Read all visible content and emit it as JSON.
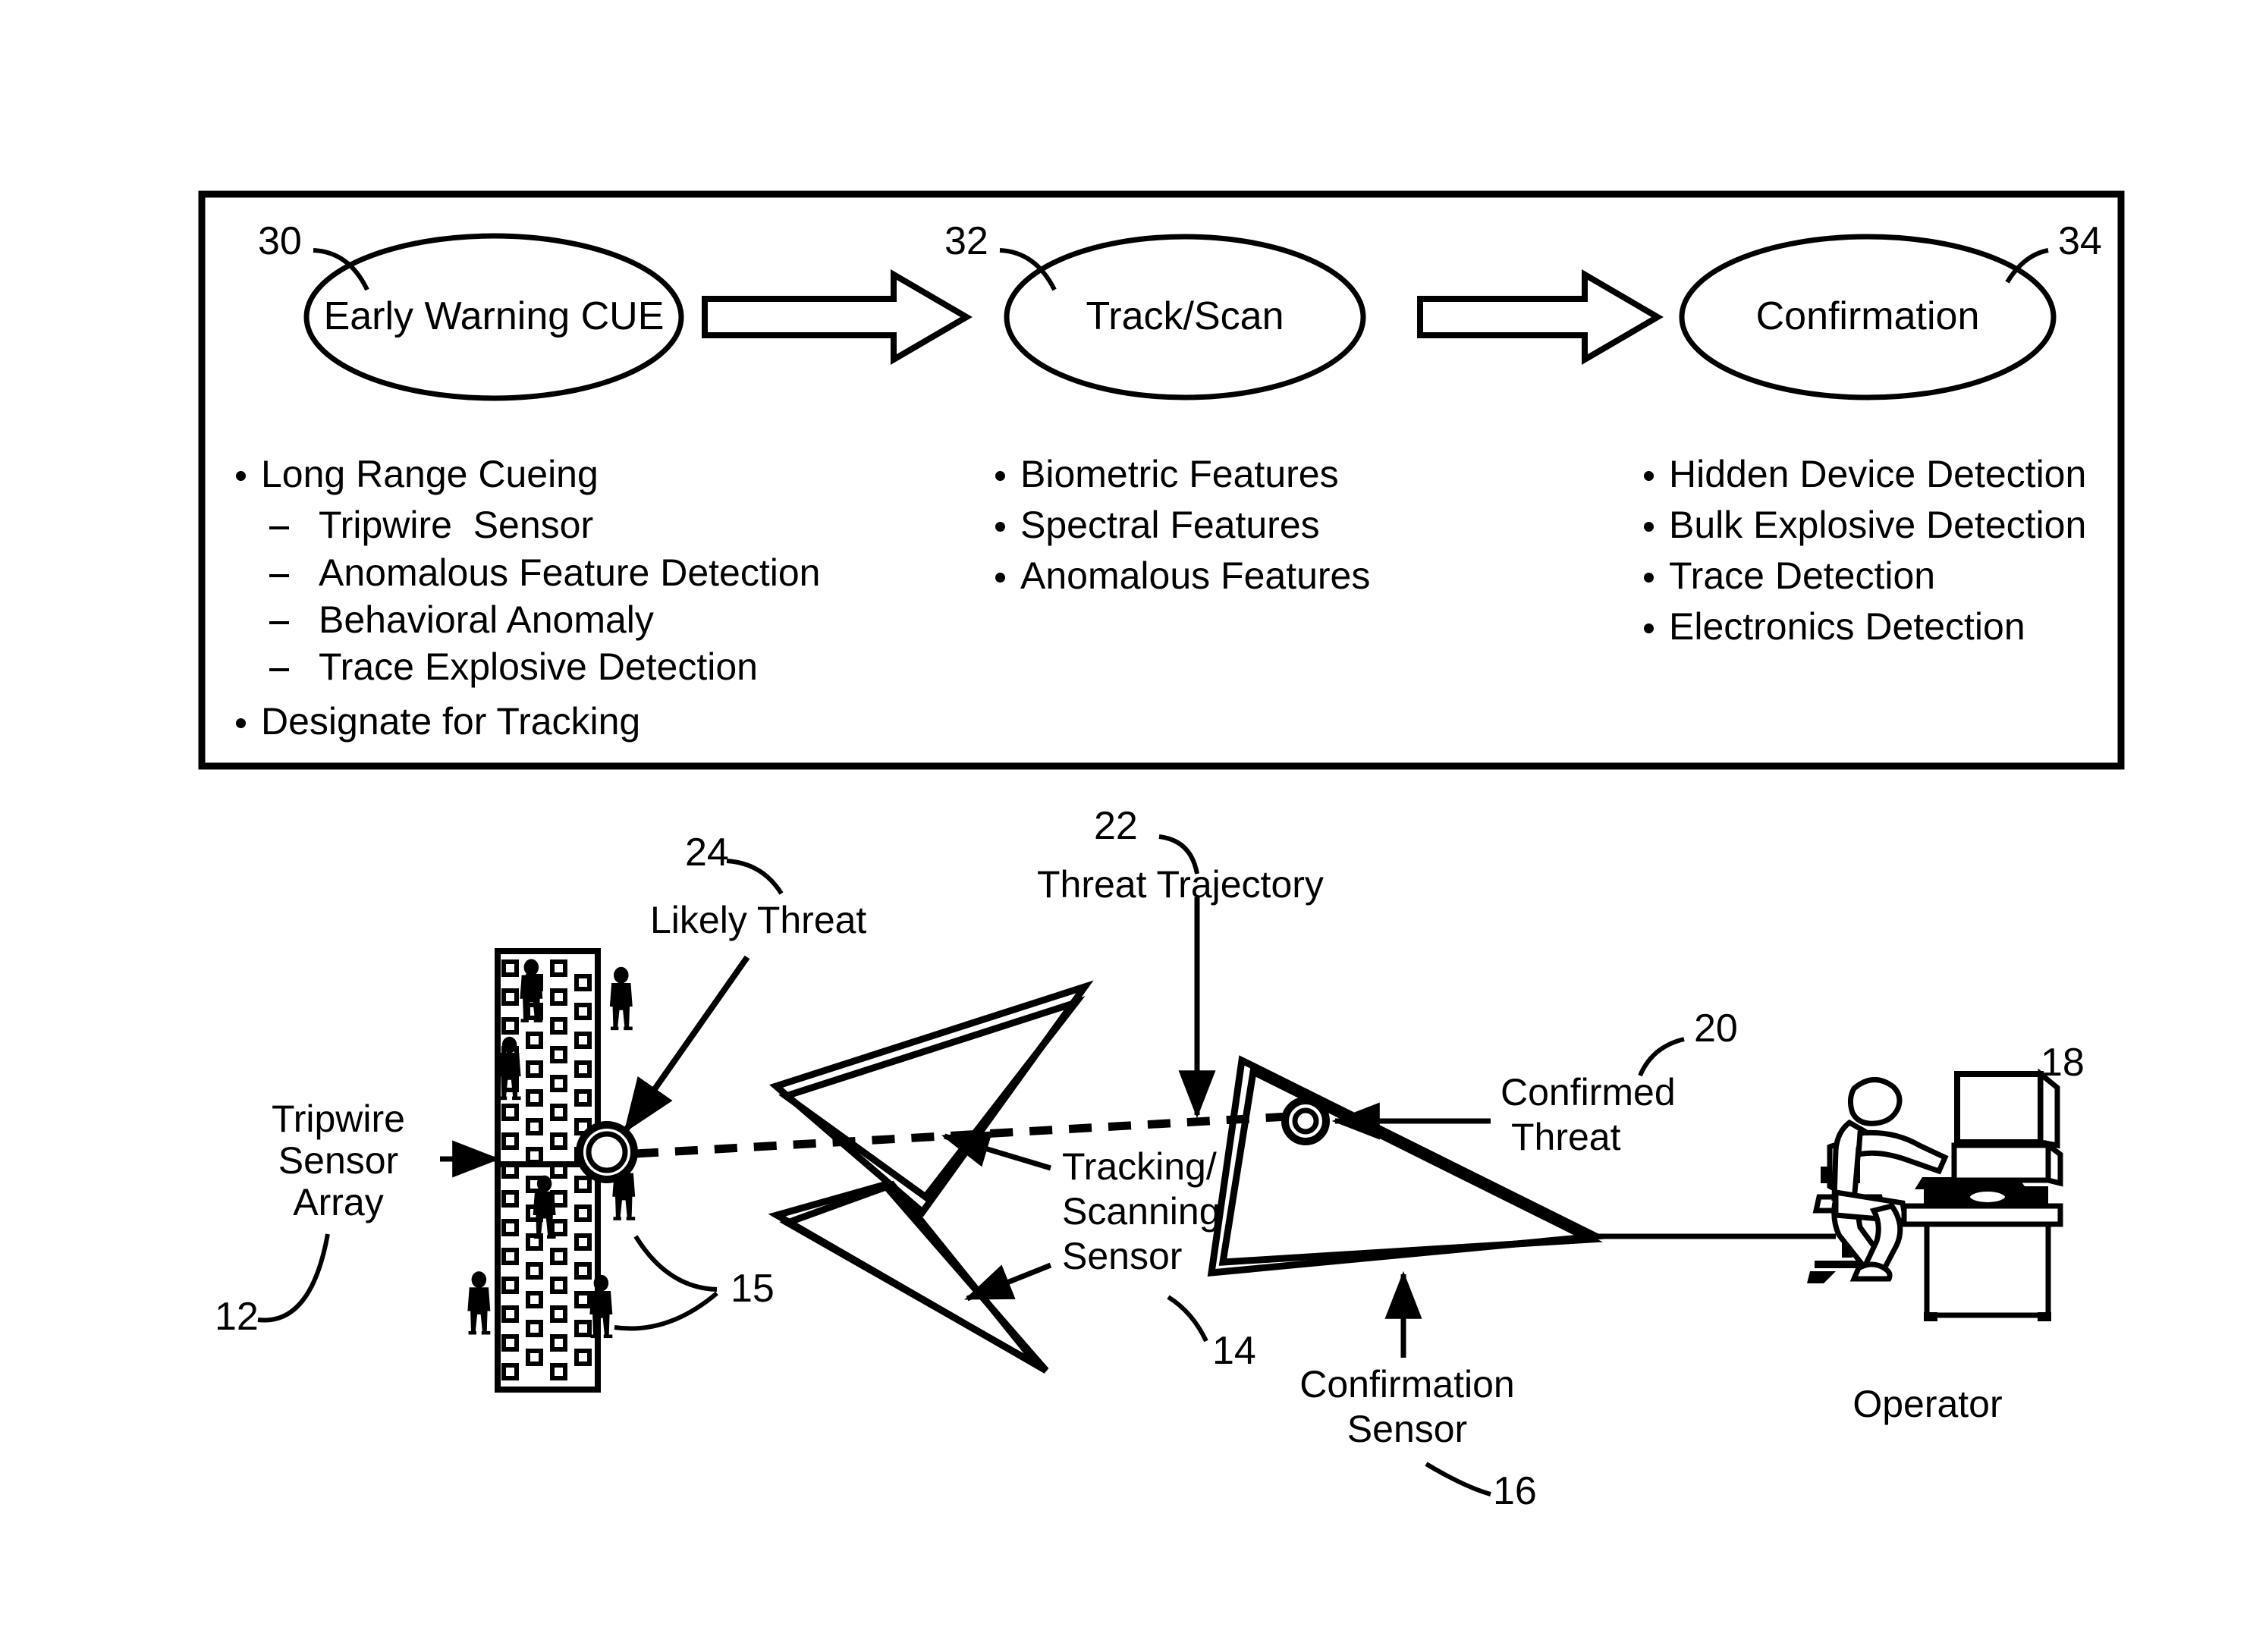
{
  "figure": {
    "top_panel": {
      "border_color": "#000000",
      "stages": [
        {
          "ref": "30",
          "label": "Early Warning CUE"
        },
        {
          "ref": "32",
          "label": "Track/Scan"
        },
        {
          "ref": "34",
          "label": "Confirmation"
        }
      ],
      "arrow_count": 2,
      "columns": [
        {
          "items": [
            {
              "level": 1,
              "marker": "bullet",
              "text": "Long Range Cueing"
            },
            {
              "level": 2,
              "marker": "dash",
              "text": "Tripwire  Sensor"
            },
            {
              "level": 2,
              "marker": "dash",
              "text": "Anomalous Feature Detection"
            },
            {
              "level": 2,
              "marker": "dash",
              "text": "Behavioral Anomaly"
            },
            {
              "level": 2,
              "marker": "dash",
              "text": "Trace Explosive Detection"
            },
            {
              "level": 1,
              "marker": "bullet",
              "text": "Designate for Tracking"
            }
          ]
        },
        {
          "items": [
            {
              "level": 1,
              "marker": "bullet",
              "text": "Biometric Features"
            },
            {
              "level": 1,
              "marker": "bullet",
              "text": "Spectral Features"
            },
            {
              "level": 1,
              "marker": "bullet",
              "text": "Anomalous Features"
            }
          ]
        },
        {
          "items": [
            {
              "level": 1,
              "marker": "bullet",
              "text": "Hidden Device Detection"
            },
            {
              "level": 1,
              "marker": "bullet",
              "text": "Bulk Explosive Detection"
            },
            {
              "level": 1,
              "marker": "bullet",
              "text": "Trace Detection"
            },
            {
              "level": 1,
              "marker": "bullet",
              "text": "Electronics Detection"
            }
          ]
        }
      ]
    },
    "scene": {
      "labels": {
        "tripwire_sensor_array": "Tripwire\nSensor\nArray",
        "tripwire_sensor_array_line1": "Tripwire",
        "tripwire_sensor_array_line2": "Sensor",
        "tripwire_sensor_array_line3": "Array",
        "likely_threat": "Likely Threat",
        "threat_trajectory": "Threat Trajectory",
        "tracking_scanning_sensor_line1": "Tracking/",
        "tracking_scanning_sensor_line2": "Scanning",
        "tracking_scanning_sensor_line3": "Sensor",
        "confirmed_threat_line1": "Confirmed",
        "confirmed_threat_line2": "Threat",
        "confirmation_sensor_line1": "Confirmation",
        "confirmation_sensor_line2": "Sensor",
        "operator": "Operator"
      },
      "refs": {
        "tripwire_array": "12",
        "pedestrians": "15",
        "tracking_sensor": "14",
        "confirmation_sensor": "16",
        "operator_workstation": "18",
        "confirmed_threat": "20",
        "threat_trajectory": "22",
        "likely_threat": "24"
      }
    }
  }
}
